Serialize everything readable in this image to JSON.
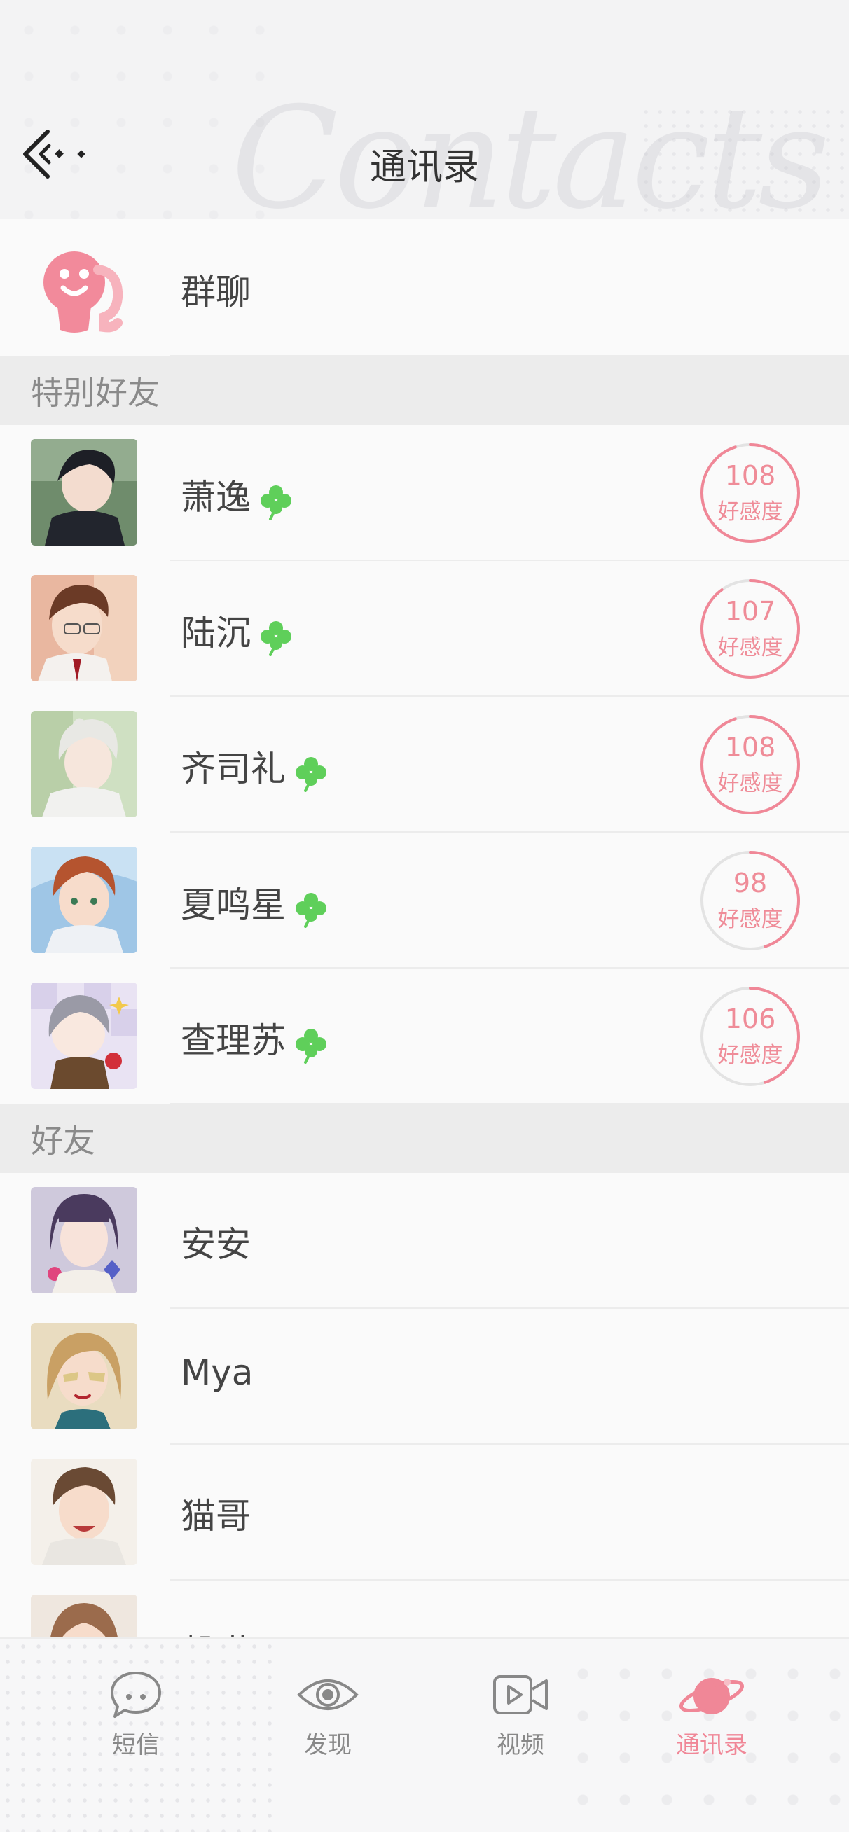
{
  "header": {
    "title": "通讯录",
    "watermark": "Contacts"
  },
  "group_chat": {
    "label": "群聊"
  },
  "special_friends": {
    "title": "特别好友",
    "affinity_label": "好感度",
    "items": [
      {
        "name": "萧逸",
        "affinity": "108",
        "ring_fraction": 0.95
      },
      {
        "name": "陆沉",
        "affinity": "107",
        "ring_fraction": 0.9
      },
      {
        "name": "齐司礼",
        "affinity": "108",
        "ring_fraction": 0.95
      },
      {
        "name": "夏鸣星",
        "affinity": "98",
        "ring_fraction": 0.45
      },
      {
        "name": "查理苏",
        "affinity": "106",
        "ring_fraction": 0.45
      }
    ]
  },
  "friends": {
    "title": "好友",
    "items": [
      {
        "name": "安安"
      },
      {
        "name": "Mya"
      },
      {
        "name": "猫哥"
      },
      {
        "name": "凯琳"
      }
    ]
  },
  "tabbar": {
    "tabs": [
      {
        "label": "短信",
        "icon": "chat-bubble-icon"
      },
      {
        "label": "发现",
        "icon": "eye-icon"
      },
      {
        "label": "视频",
        "icon": "video-icon"
      },
      {
        "label": "通讯录",
        "icon": "planet-icon",
        "active": true
      }
    ]
  },
  "colors": {
    "accent": "#f08797",
    "clover": "#5fcf5a",
    "ring_track": "#e3e3e3"
  }
}
